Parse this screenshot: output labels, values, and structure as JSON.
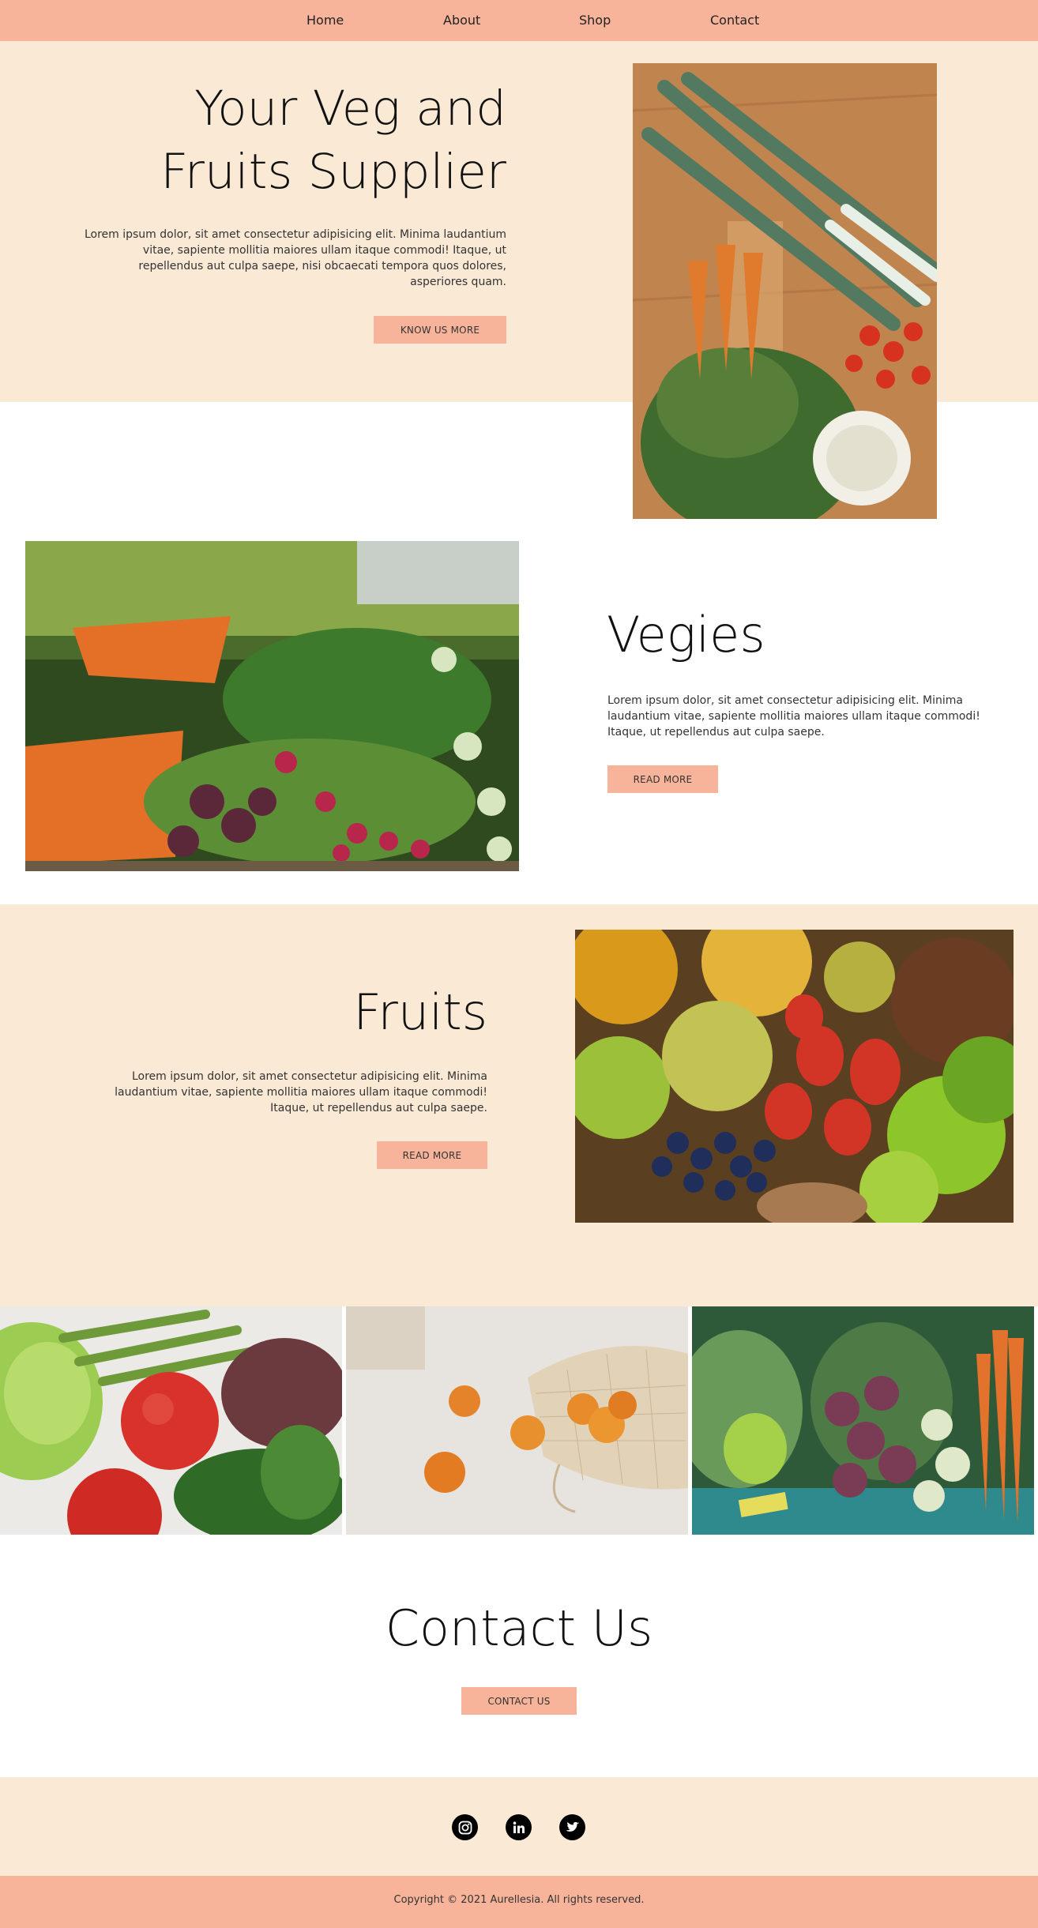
{
  "nav": {
    "items": [
      "Home",
      "About",
      "Shop",
      "Contact"
    ]
  },
  "hero": {
    "title_line1": "Your Veg and",
    "title_line2": "Fruits Supplier",
    "text": "Lorem ipsum dolor, sit amet consectetur adipisicing elit. Minima laudantium vitae, sapiente mollitia maiores ullam itaque commodi! Itaque, ut repellendus aut culpa saepe, nisi obcaecati tempora quos dolores, asperiores quam.",
    "button": "KNOW US MORE"
  },
  "vegies": {
    "title": "Vegies",
    "text": "Lorem ipsum dolor, sit amet consectetur adipisicing elit. Minima laudantium vitae, sapiente mollitia maiores ullam itaque commodi! Itaque, ut repellendus aut culpa saepe.",
    "button": "READ MORE"
  },
  "fruits": {
    "title": "Fruits",
    "text": "Lorem ipsum dolor, sit amet consectetur adipisicing elit. Minima laudantium vitae, sapiente mollitia maiores ullam itaque commodi! Itaque, ut repellendus aut culpa saepe.",
    "button": "READ MORE"
  },
  "contact": {
    "title": "Contact Us",
    "button": "CONTACT US"
  },
  "social": {
    "icons": [
      "instagram-icon",
      "linkedin-icon",
      "twitter-icon"
    ]
  },
  "footer": {
    "copyright": "Copyright © 2021 Aurellesia. All rights reserved."
  },
  "colors": {
    "accent": "#f7b49a",
    "cream": "#fae9d5",
    "text": "#111111"
  }
}
